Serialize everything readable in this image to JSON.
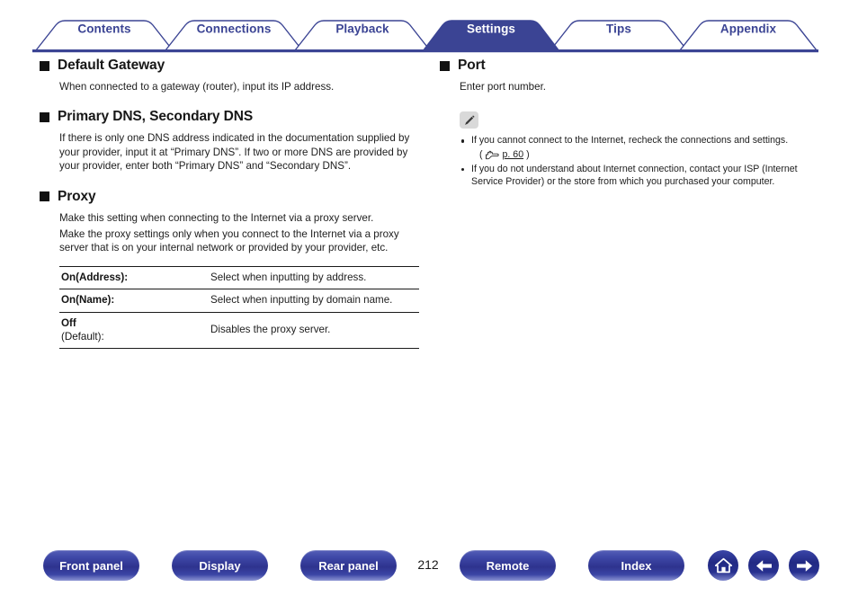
{
  "nav": {
    "tabs": [
      {
        "label": "Contents",
        "active": false
      },
      {
        "label": "Connections",
        "active": false
      },
      {
        "label": "Playback",
        "active": false
      },
      {
        "label": "Settings",
        "active": true
      },
      {
        "label": "Tips",
        "active": false
      },
      {
        "label": "Appendix",
        "active": false
      }
    ],
    "accent_color": "#3b4494",
    "active_fill": "#3b4494",
    "active_text_color": "#ffffff"
  },
  "left_column": {
    "sections": [
      {
        "heading": "Default Gateway",
        "paragraphs": [
          "When connected to a gateway (router), input its IP address."
        ]
      },
      {
        "heading": "Primary DNS, Secondary DNS",
        "paragraphs": [
          "If there is only one DNS address indicated in the documentation supplied by your provider, input it at “Primary DNS”. If two or more DNS are provided by your provider, enter both “Primary DNS” and “Secondary DNS”."
        ]
      },
      {
        "heading": "Proxy",
        "paragraphs": [
          "Make this setting when connecting to the Internet via a proxy server.",
          "Make the proxy settings only when you connect to the Internet via a proxy server that is on your internal network or provided by your provider, etc."
        ]
      }
    ],
    "options_table": {
      "rows": [
        {
          "key": "On(Address):",
          "sub": "",
          "value": "Select when inputting by address."
        },
        {
          "key": "On(Name):",
          "sub": "",
          "value": "Select when inputting by domain name."
        },
        {
          "key": "Off",
          "sub": "(Default):",
          "value": "Disables the proxy server."
        }
      ]
    }
  },
  "right_column": {
    "sections": [
      {
        "heading": "Port",
        "paragraphs": [
          "Enter port number."
        ]
      }
    ],
    "note": {
      "icon": "pencil-note-icon",
      "items": [
        {
          "text": "If you cannot connect to the Internet, recheck the connections and settings.",
          "reference": {
            "glyph": "pointing-hand-icon",
            "label": "p. 60",
            "prefix": "(",
            "suffix": ")"
          }
        },
        {
          "text": "If you do not understand about Internet connection, contact your ISP (Internet Service Provider) or the store from which you purchased your computer.",
          "reference": null
        }
      ]
    }
  },
  "footer": {
    "page_number": "212",
    "buttons": [
      {
        "label": "Front panel",
        "name": "front-panel-button"
      },
      {
        "label": "Display",
        "name": "display-button"
      },
      {
        "label": "Rear panel",
        "name": "rear-panel-button"
      },
      {
        "label": "Remote",
        "name": "remote-button"
      },
      {
        "label": "Index",
        "name": "index-button"
      }
    ],
    "icon_buttons": [
      {
        "icon": "home-icon"
      },
      {
        "icon": "arrow-left-icon"
      },
      {
        "icon": "arrow-right-icon"
      }
    ]
  }
}
